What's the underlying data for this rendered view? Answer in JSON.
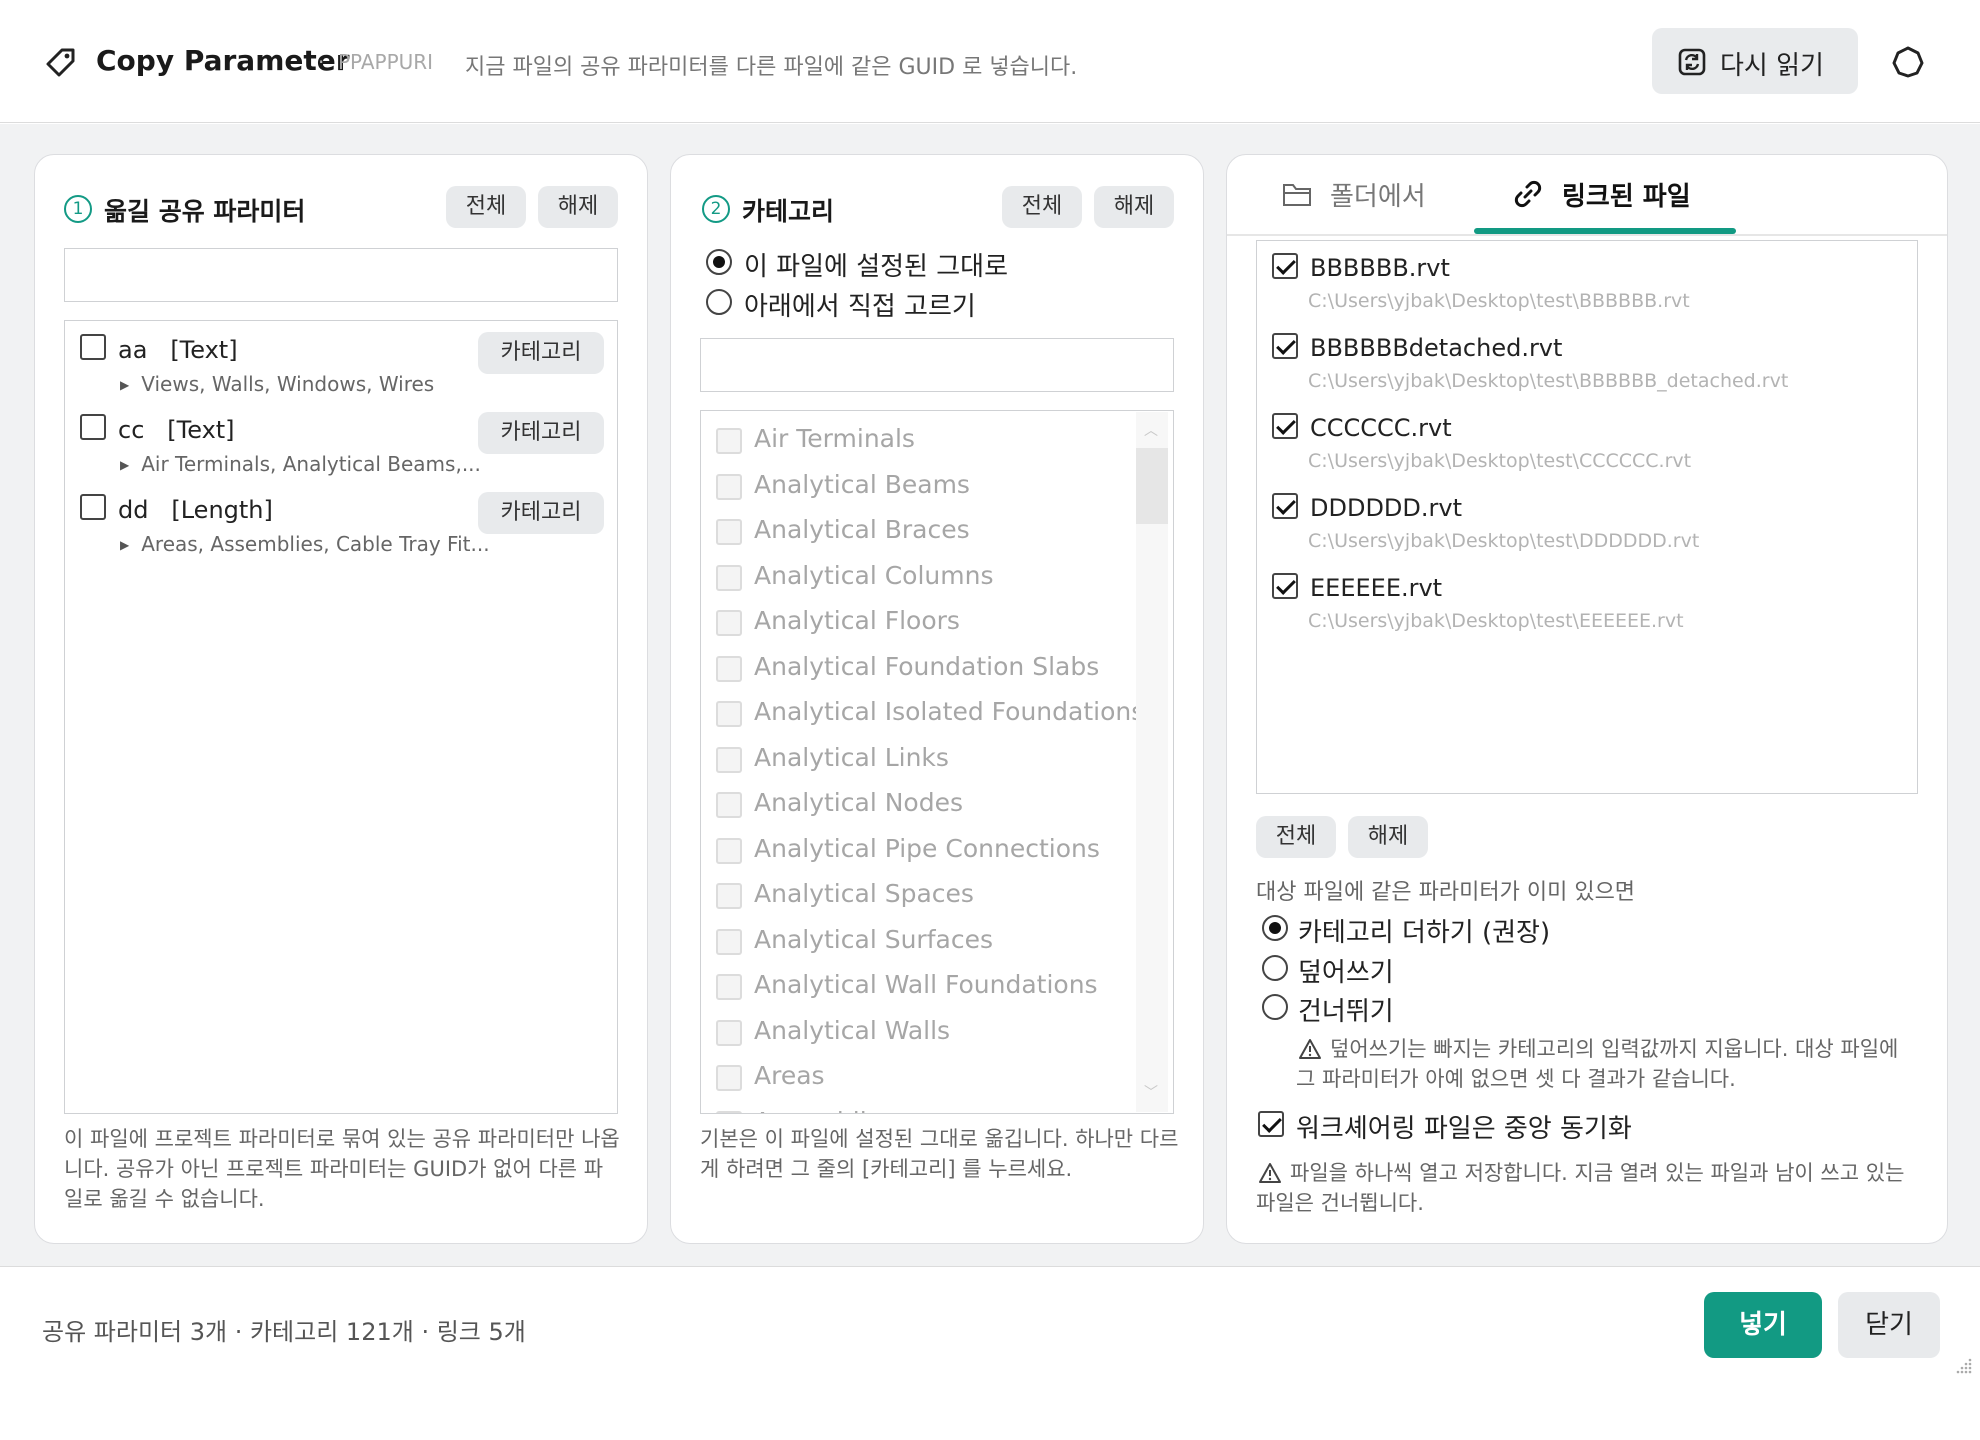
{
  "header": {
    "title": "Copy Parameter",
    "separator": "·",
    "author": "PPAPPURI",
    "description": "지금 파일의 공유 파라미터를 다른 파일에 같은 GUID 로 넣습니다.",
    "reload_label": "다시 읽기"
  },
  "params_panel": {
    "number": "1",
    "title": "옮길 공유 파라미터",
    "all_label": "전체",
    "clear_label": "해제",
    "items": [
      {
        "name": "aa",
        "type": "[Text]",
        "categories": "Views, Walls, Windows, Wires",
        "button": "카테고리",
        "checked": false
      },
      {
        "name": "cc",
        "type": "[Text]",
        "categories": "Air Terminals, Analytical Beams,...",
        "button": "카테고리",
        "checked": false
      },
      {
        "name": "dd",
        "type": "[Length]",
        "categories": "Areas, Assemblies, Cable Tray Fit...",
        "button": "카테고리",
        "checked": false
      }
    ],
    "note": "이 파일에 프로젝트 파라미터로 묶여 있는 공유 파라미터만 나옵니다. 공유가 아닌 프로젝트 파라미터는 GUID가 없어 다른 파일로 옮길 수 없습니다."
  },
  "category_panel": {
    "number": "2",
    "title": "카테고리",
    "all_label": "전체",
    "clear_label": "해제",
    "radio_same": "이 파일에 설정된 그대로",
    "radio_pick": "아래에서 직접 고르기",
    "selected_mode": "same",
    "categories": [
      "Air Terminals",
      "Analytical Beams",
      "Analytical Braces",
      "Analytical Columns",
      "Analytical Floors",
      "Analytical Foundation Slabs",
      "Analytical Isolated Foundations",
      "Analytical Links",
      "Analytical Nodes",
      "Analytical Pipe Connections",
      "Analytical Spaces",
      "Analytical Surfaces",
      "Analytical Wall Foundations",
      "Analytical Walls",
      "Areas",
      "Assemblies"
    ],
    "note": "기본은 이 파일에 설정된 그대로 옮깁니다. 하나만 다르게 하려면 그 줄의 [카테고리] 를 누르세요."
  },
  "target_panel": {
    "tab_folder": "폴더에서",
    "tab_linked": "링크된 파일",
    "active_tab": "linked",
    "files": [
      {
        "name": "BBBBBB.rvt",
        "path": "C:\\Users\\yjbak\\Desktop\\test\\BBBBBB.rvt",
        "checked": true
      },
      {
        "name": "BBBBBBdetached.rvt",
        "path": "C:\\Users\\yjbak\\Desktop\\test\\BBBBBB_detached.rvt",
        "checked": true
      },
      {
        "name": "CCCCCC.rvt",
        "path": "C:\\Users\\yjbak\\Desktop\\test\\CCCCCC.rvt",
        "checked": true
      },
      {
        "name": "DDDDDD.rvt",
        "path": "C:\\Users\\yjbak\\Desktop\\test\\DDDDDD.rvt",
        "checked": true
      },
      {
        "name": "EEEEEE.rvt",
        "path": "C:\\Users\\yjbak\\Desktop\\test\\EEEEEE.rvt",
        "checked": true
      }
    ],
    "all_label": "전체",
    "clear_label": "해제",
    "exists_label": "대상 파일에 같은 파라미터가 이미 있으면",
    "opt_add": "카테고리 더하기 (권장)",
    "opt_overwrite": "덮어쓰기",
    "opt_skip": "건너뛰기",
    "selected_option": "add",
    "warning_overwrite": "덮어쓰기는 빠지는 카테고리의 입력값까지 지웁니다. 대상 파일에 그 파라미터가 아예 없으면 셋 다 결과가 같습니다.",
    "sync_label": "워크셰어링 파일은 중앙 동기화",
    "sync_checked": true,
    "warning_sync": "파일을 하나씩 열고 저장합니다. 지금 열려 있는 파일과 남이 쓰고 있는 파일은 건너뜁니다."
  },
  "footer": {
    "status": "공유 파라미터 3개 · 카테고리 121개 · 링크 5개",
    "insert_label": "넣기",
    "close_label": "닫기"
  },
  "colors": {
    "accent": "#129a83",
    "step_number": "#139a85",
    "panel_bg": "#f1f2f3"
  }
}
